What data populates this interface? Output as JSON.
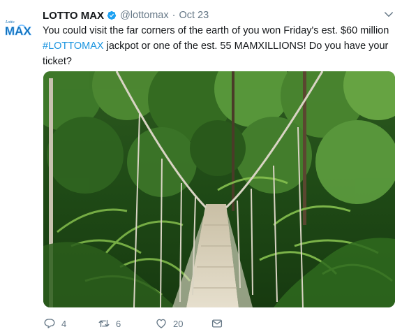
{
  "tweet": {
    "display_name": "LOTTO MAX",
    "handle": "@lottomax",
    "separator": "·",
    "timestamp": "Oct 23",
    "text_before": "You could visit the far corners of the earth of you won Friday's est. $60 million ",
    "hashtag": "#LOTTOMAX",
    "text_after": " jackpot or one of the est. 55 MAMXILLIONS! Do you have your ticket?",
    "avatar_logo_text": {
      "small": "Lotto",
      "large": "MAX"
    },
    "media_alt": "Suspension rope bridge through a tropical jungle",
    "replies": "4",
    "retweets": "6",
    "likes": "20"
  },
  "colors": {
    "accent": "#1b95e0",
    "muted": "#657786",
    "text": "#14171a",
    "logo": "#0a6ab3"
  },
  "icons": [
    "verified-badge-icon",
    "chevron-down-icon",
    "reply-icon",
    "retweet-icon",
    "like-icon",
    "direct-message-icon"
  ]
}
